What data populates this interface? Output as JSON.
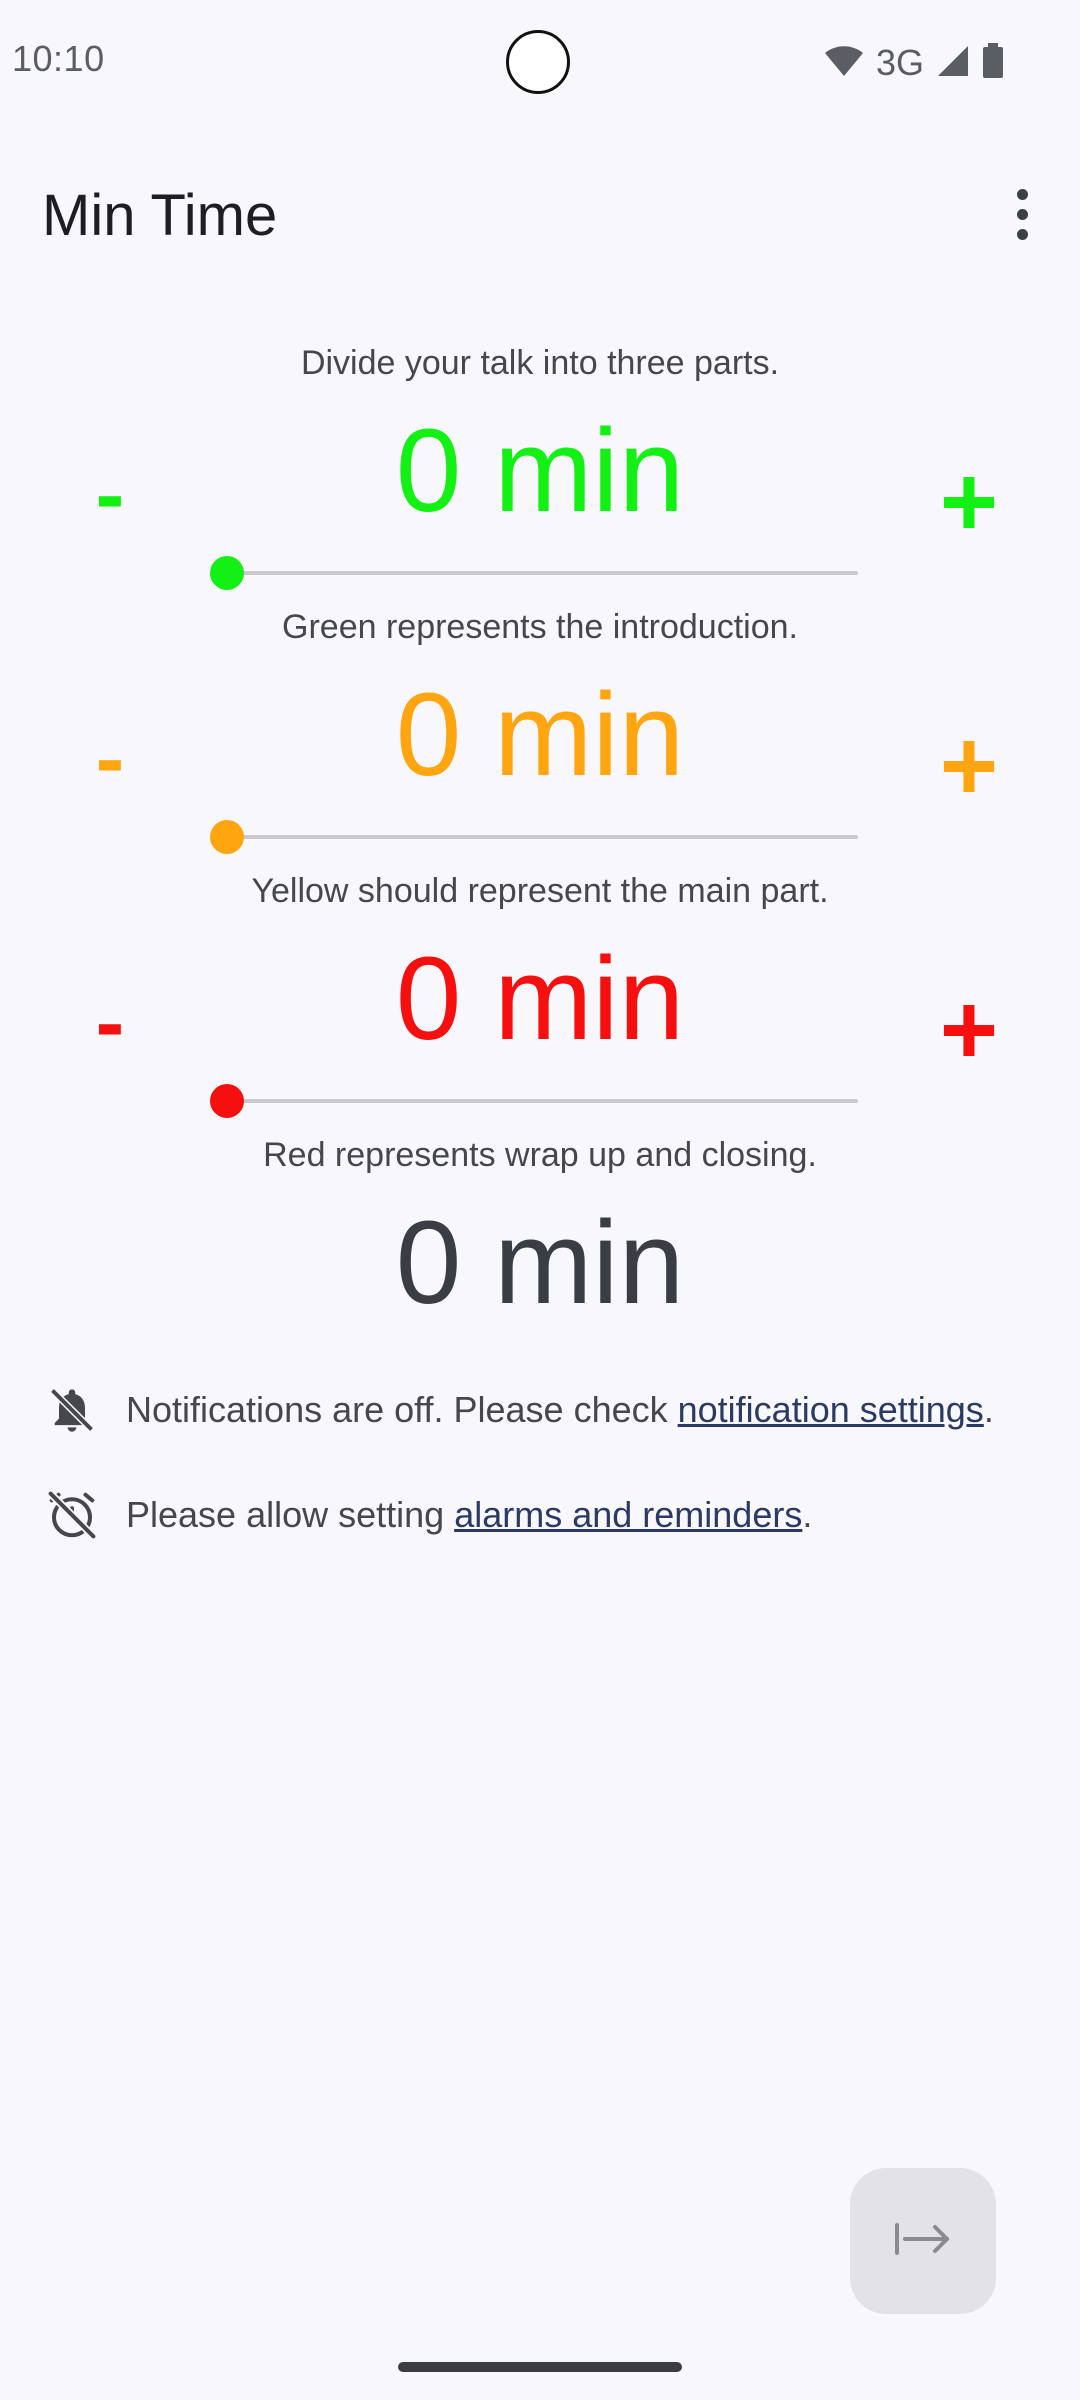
{
  "status_bar": {
    "time": "10:10",
    "network": "3G",
    "icons": [
      "wifi-icon",
      "cellular-signal-icon",
      "battery-icon"
    ]
  },
  "app_bar": {
    "title": "Min Time",
    "menu_icon": "more-vert-icon"
  },
  "intro_text": "Divide your talk into three parts.",
  "sections": [
    {
      "id": "introduction",
      "color": "#13f013",
      "value_label": "0 min",
      "minus_label": "-",
      "plus_label": "+",
      "slider_value": 0,
      "caption": "Green represents the introduction."
    },
    {
      "id": "main",
      "color": "#ffa50f",
      "value_label": "0 min",
      "minus_label": "-",
      "plus_label": "+",
      "slider_value": 0,
      "caption": "Yellow should represent the main part."
    },
    {
      "id": "closing",
      "color": "#f50f0f",
      "value_label": "0 min",
      "minus_label": "-",
      "plus_label": "+",
      "slider_value": 0,
      "caption": "Red represents wrap up and closing."
    }
  ],
  "total_label": "0 min",
  "notifications_notice": {
    "icon": "notifications-off-icon",
    "prefix": "Notifications are off. Please check ",
    "link": "notification settings",
    "suffix": "."
  },
  "alarms_notice": {
    "icon": "alarm-off-icon",
    "prefix": "Please allow setting ",
    "link": "alarms and reminders",
    "suffix": "."
  },
  "fab": {
    "icon": "start-arrow-icon"
  }
}
